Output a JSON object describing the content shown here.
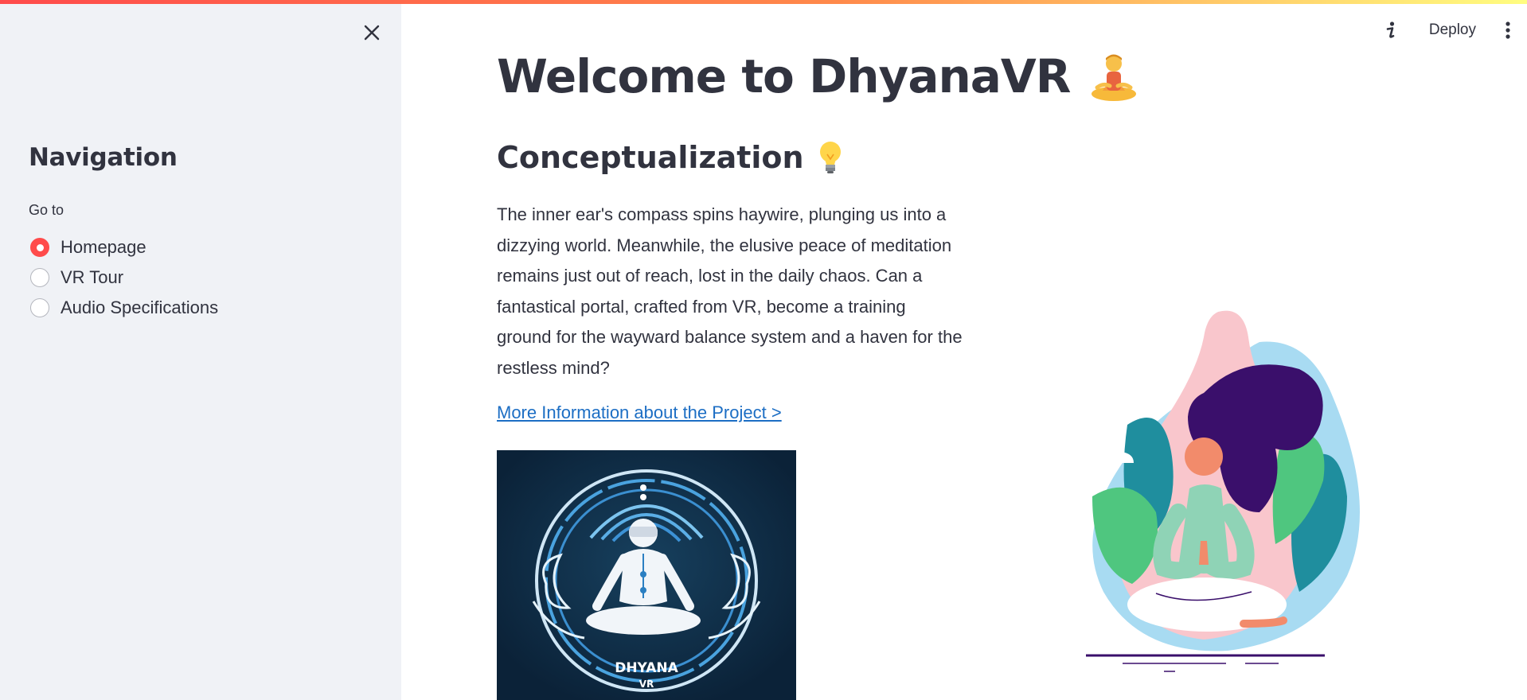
{
  "sidebar": {
    "title": "Navigation",
    "goto_label": "Go to",
    "options": [
      {
        "label": "Homepage",
        "selected": true
      },
      {
        "label": "VR Tour",
        "selected": false
      },
      {
        "label": "Audio Specifications",
        "selected": false
      }
    ],
    "close_icon": "close-icon"
  },
  "header": {
    "deploy_label": "Deploy",
    "info_icon": "info-icon",
    "menu_icon": "kebab-menu-icon"
  },
  "main": {
    "title": "Welcome to DhyanaVR",
    "title_emoji": "meditating-person-emoji",
    "subtitle": "Conceptualization",
    "subtitle_emoji": "light-bulb-emoji",
    "body": "The inner ear's compass spins haywire, plunging us into a dizzying world. Meanwhile, the elusive peace of meditation remains just out of reach, lost in the daily chaos. Can a fantastical portal, crafted from VR, become a training ground for the wayward balance system and a haven for the restless mind?",
    "link_text": "More Information about the Project >",
    "logo": {
      "line1": "DHYANA",
      "line2": "VR"
    }
  },
  "colors": {
    "accent": "#ff4b4b",
    "link": "#1c6ec4",
    "sidebar_bg": "#f0f2f6",
    "text": "#31333f"
  }
}
